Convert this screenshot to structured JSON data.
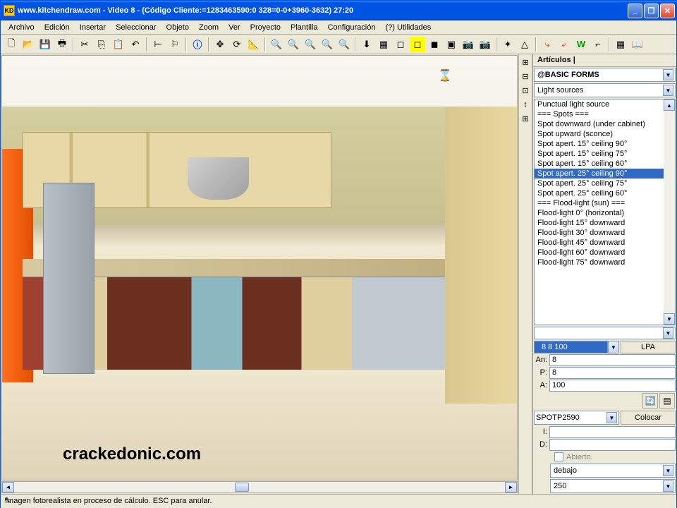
{
  "title": "www.kitchendraw.com - Video 8 - (Código Cliente:=1283463590:0 328=0-0+3960-3632) 27:20",
  "app_icon": "KD",
  "menu": [
    "Archivo",
    "Edición",
    "Insertar",
    "Seleccionar",
    "Objeto",
    "Zoom",
    "Ver",
    "Proyecto",
    "Plantilla",
    "Configuración",
    "(?) Utilidades"
  ],
  "watermark": "crackedonic.com",
  "panel": {
    "header": "Artículos",
    "catalog": "@BASIC FORMS",
    "category": "Light sources",
    "items": [
      "Punctual light source",
      "=== Spots ===",
      "Spot downward (under cabinet)",
      "Spot upward (sconce)",
      "Spot apert. 15° ceiling 90°",
      "Spot apert. 15° ceiling 75°",
      "Spot apert. 15° ceiling 60°",
      "Spot apert. 25° ceiling 90°",
      "Spot apert. 25° ceiling 75°",
      "Spot apert. 25° ceiling 60°",
      "=== Flood-light (sun) ===",
      "Flood-light 0° (horizontal)",
      "Flood-light 15° downward",
      "Flood-light 30° downward",
      "Flood-light 45° downward",
      "Flood-light 60° downward",
      "Flood-light 75° downward"
    ],
    "selected_index": 7,
    "dimensions": "8   8 100",
    "lpa": "LPA",
    "fields": {
      "an_label": "An:",
      "an": "8",
      "p_label": "P:",
      "p": "8",
      "a_label": "A:",
      "a": "100",
      "i_label": "I:",
      "i": "",
      "d_label": "D:",
      "d": ""
    },
    "product_code": "SPOTP2590",
    "place_btn": "Colocar",
    "open_check": "Abierto",
    "position_dd": "debajo",
    "value_dd": "250"
  },
  "statusbar": "Imagen fotorealista en proceso de cálculo. ESC para anular."
}
